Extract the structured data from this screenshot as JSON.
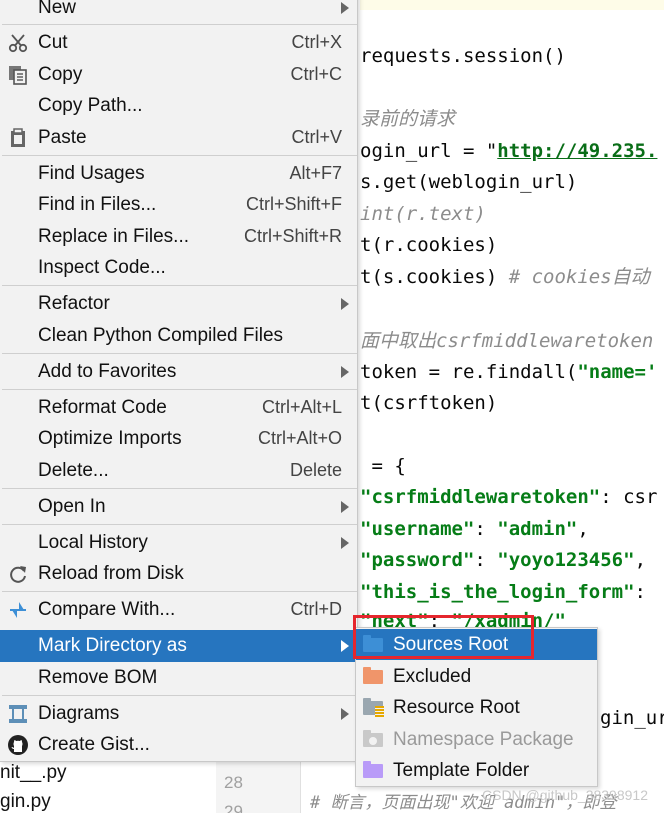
{
  "editor": {
    "lines": [
      {
        "text": "requests.session()"
      },
      {
        "text": "录前的请求",
        "comment": true
      },
      {
        "pre": "ogin_url = \"",
        "url": "http://49.235.",
        "post": ""
      },
      {
        "text": "s.get(weblogin_url)"
      },
      {
        "text": "int(r.text)",
        "comment": true
      },
      {
        "text": "t(r.cookies)"
      },
      {
        "pre": "t(s.cookies) ",
        "cmt": "# cookies自动"
      },
      {
        "text": "面中取出csrfmiddlewaretoken",
        "comment": true
      },
      {
        "pre": "token = re.findall(",
        "str": "\"name='"
      },
      {
        "text": "t(csrftoken)"
      },
      {
        "text": " = {"
      },
      {
        "str": "\"csrfmiddlewaretoken\"",
        "post": ": csr"
      },
      {
        "str": "\"username\"",
        "post": ": ",
        "str2": "\"admin\"",
        "post2": ","
      },
      {
        "str": "\"password\"",
        "post": ": ",
        "str2": "\"yoyo123456\"",
        "post2": ","
      },
      {
        "str": "\"this_is_the_login_form\"",
        "post": ":"
      },
      {
        "str": "\"next\"",
        "post": ": ",
        "str2": "\"/xadmin/\""
      },
      {
        "text": "gin_ur"
      }
    ],
    "gutter_numbers": [
      "28",
      "29"
    ],
    "tree_files": [
      "nit__.py",
      "gin.py"
    ],
    "bottom_comment": "# 断言，页面出现\"欢迎 admin\"，即登"
  },
  "menu": {
    "items": [
      {
        "label": "New",
        "arrow": true
      },
      {
        "label": "Cut",
        "shortcut": "Ctrl+X",
        "icon": "scissors-icon"
      },
      {
        "label": "Copy",
        "shortcut": "Ctrl+C",
        "icon": "copy-icon"
      },
      {
        "label": "Copy Path..."
      },
      {
        "label": "Paste",
        "shortcut": "Ctrl+V",
        "icon": "clipboard-icon"
      },
      {
        "label": "Find Usages",
        "shortcut": "Alt+F7"
      },
      {
        "label": "Find in Files...",
        "shortcut": "Ctrl+Shift+F"
      },
      {
        "label": "Replace in Files...",
        "shortcut": "Ctrl+Shift+R"
      },
      {
        "label": "Inspect Code..."
      },
      {
        "label": "Refactor",
        "arrow": true
      },
      {
        "label": "Clean Python Compiled Files"
      },
      {
        "label": "Add to Favorites",
        "arrow": true
      },
      {
        "label": "Reformat Code",
        "shortcut": "Ctrl+Alt+L"
      },
      {
        "label": "Optimize Imports",
        "shortcut": "Ctrl+Alt+O"
      },
      {
        "label": "Delete...",
        "shortcut": "Delete"
      },
      {
        "label": "Open In",
        "arrow": true
      },
      {
        "label": "Local History",
        "arrow": true
      },
      {
        "label": "Reload from Disk",
        "icon": "reload-icon"
      },
      {
        "label": "Compare With...",
        "shortcut": "Ctrl+D",
        "icon": "compare-icon"
      },
      {
        "label": "Mark Directory as",
        "arrow": true,
        "selected": true
      },
      {
        "label": "Remove BOM"
      },
      {
        "label": "Diagrams",
        "arrow": true,
        "icon": "diagram-icon"
      },
      {
        "label": "Create Gist...",
        "icon": "github-icon"
      }
    ]
  },
  "submenu": {
    "items": [
      {
        "label": "Sources Root",
        "icon": "sources-folder-icon",
        "color": "#3d8fd6",
        "selected": true
      },
      {
        "label": "Excluded",
        "icon": "excluded-folder-icon",
        "color": "#f0956a"
      },
      {
        "label": "Resource Root",
        "icon": "resource-folder-icon",
        "color": "#9aa7b0"
      },
      {
        "label": "Namespace Package",
        "icon": "namespace-folder-icon",
        "color": "#c9c9c9",
        "disabled": true
      },
      {
        "label": "Template Folder",
        "icon": "template-folder-icon",
        "color": "#b99bf8"
      }
    ]
  },
  "colors": {
    "selection": "#2675bf",
    "highlight_box": "#e5262d"
  },
  "watermark": "CSDN @github_38398912"
}
